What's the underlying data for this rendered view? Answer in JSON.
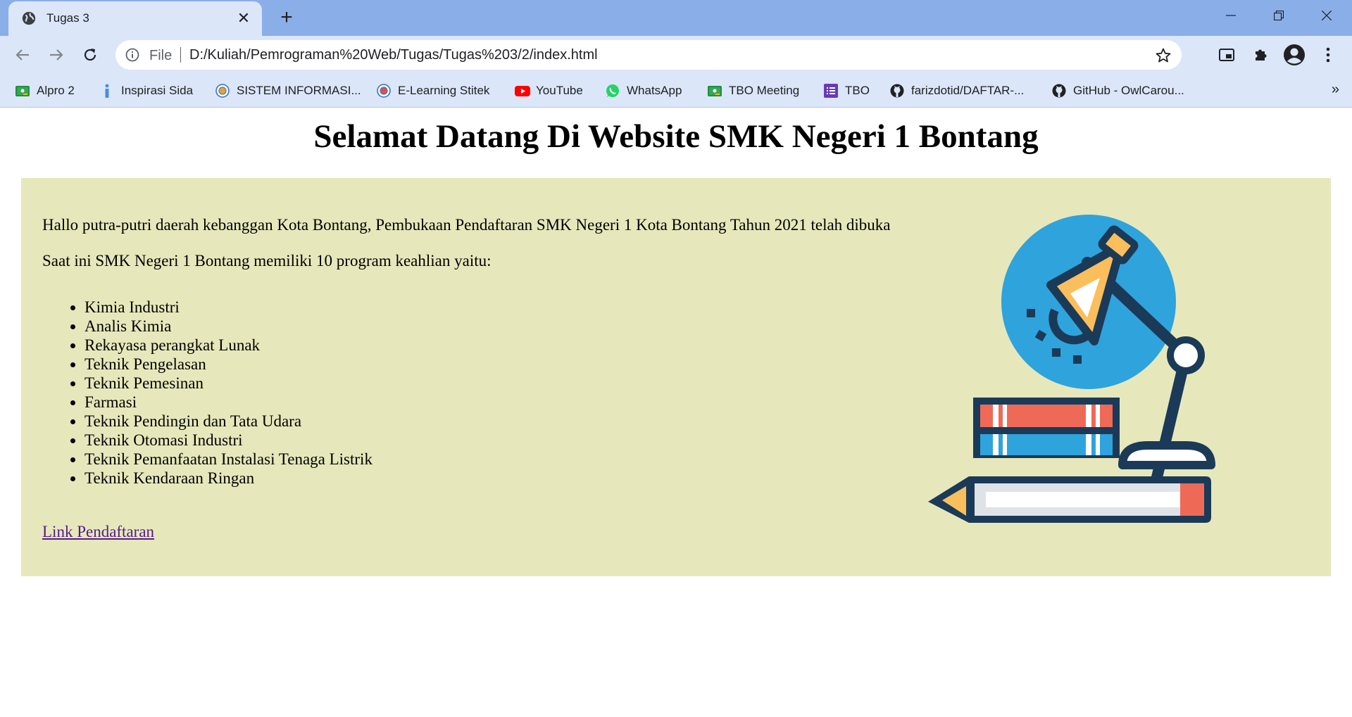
{
  "browser": {
    "tab_title": "Tugas 3",
    "address_scheme": "File",
    "address_url": "D:/Kuliah/Pemrograman%20Web/Tugas/Tugas%203/2/index.html",
    "bookmarks": [
      {
        "label": "Alpro 2",
        "icon": "google-classroom-icon"
      },
      {
        "label": "Inspirasi Sida",
        "icon": "info-person-icon"
      },
      {
        "label": "SISTEM INFORMASI...",
        "icon": "campus-logo-icon"
      },
      {
        "label": "E-Learning Stitek",
        "icon": "campus-logo-icon"
      },
      {
        "label": "YouTube",
        "icon": "youtube-icon"
      },
      {
        "label": "WhatsApp",
        "icon": "whatsapp-icon"
      },
      {
        "label": "TBO Meeting",
        "icon": "google-classroom-icon"
      },
      {
        "label": "TBO",
        "icon": "list-icon"
      },
      {
        "label": "farizdotid/DAFTAR-...",
        "icon": "github-icon"
      },
      {
        "label": "GitHub - OwlCarou...",
        "icon": "github-icon"
      }
    ],
    "bookmarks_overflow": "»",
    "accent_color": "#8aaee8",
    "toolbar_color": "#dbe6f9"
  },
  "page": {
    "heading": "Selamat Datang Di Website SMK Negeri 1 Bontang",
    "intro": "Hallo putra-putri daerah kebanggan Kota Bontang, Pembukaan Pendaftaran SMK Negeri 1 Kota Bontang Tahun 2021 telah dibuka",
    "programs_intro": "Saat ini SMK Negeri 1 Bontang memiliki 10 program keahlian yaitu:",
    "programs": [
      "Kimia Industri",
      "Analis Kimia",
      "Rekayasa perangkat Lunak",
      "Teknik Pengelasan",
      "Teknik Pemesinan",
      "Farmasi",
      "Teknik Pendingin dan Tata Udara",
      "Teknik Otomasi Industri",
      "Teknik Pemanfaatan Instalasi Tenaga Listrik",
      "Teknik Kendaraan Ringan"
    ],
    "link_label": "Link Pendaftaran",
    "panel_color": "#e6e8bb",
    "illustration_icon": "desk-lamp-books-pencil-icon"
  }
}
